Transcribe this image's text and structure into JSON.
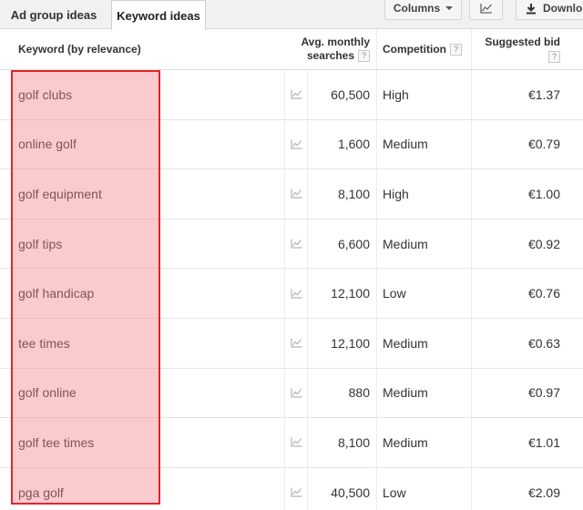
{
  "tabs": {
    "ad_group_ideas": "Ad group ideas",
    "keyword_ideas": "Keyword ideas"
  },
  "toolbar": {
    "columns_label": "Columns",
    "download_label": "Downlo",
    "chart_icon": "line-chart-icon",
    "download_icon": "download-arrow-icon"
  },
  "table": {
    "headers": {
      "keyword": "Keyword (by relevance)",
      "avg_monthly_1": "Avg. monthly",
      "avg_monthly_2": "searches",
      "competition": "Competition",
      "suggested_bid": "Suggested bid",
      "help": "?"
    },
    "rows": [
      {
        "keyword": "golf clubs",
        "searches": "60,500",
        "competition": "High",
        "bid": "€1.37"
      },
      {
        "keyword": "online golf",
        "searches": "1,600",
        "competition": "Medium",
        "bid": "€0.79"
      },
      {
        "keyword": "golf equipment",
        "searches": "8,100",
        "competition": "High",
        "bid": "€1.00"
      },
      {
        "keyword": "golf tips",
        "searches": "6,600",
        "competition": "Medium",
        "bid": "€0.92"
      },
      {
        "keyword": "golf handicap",
        "searches": "12,100",
        "competition": "Low",
        "bid": "€0.76"
      },
      {
        "keyword": "tee times",
        "searches": "12,100",
        "competition": "Medium",
        "bid": "€0.63"
      },
      {
        "keyword": "golf online",
        "searches": "880",
        "competition": "Medium",
        "bid": "€0.97"
      },
      {
        "keyword": "golf tee times",
        "searches": "8,100",
        "competition": "Medium",
        "bid": "€1.01"
      },
      {
        "keyword": "pga golf",
        "searches": "40,500",
        "competition": "Low",
        "bid": "€2.09"
      }
    ]
  },
  "colors": {
    "highlight_fill": "#f4808c",
    "highlight_border": "#e0252f",
    "tab_bar": "#f1f1f1"
  }
}
